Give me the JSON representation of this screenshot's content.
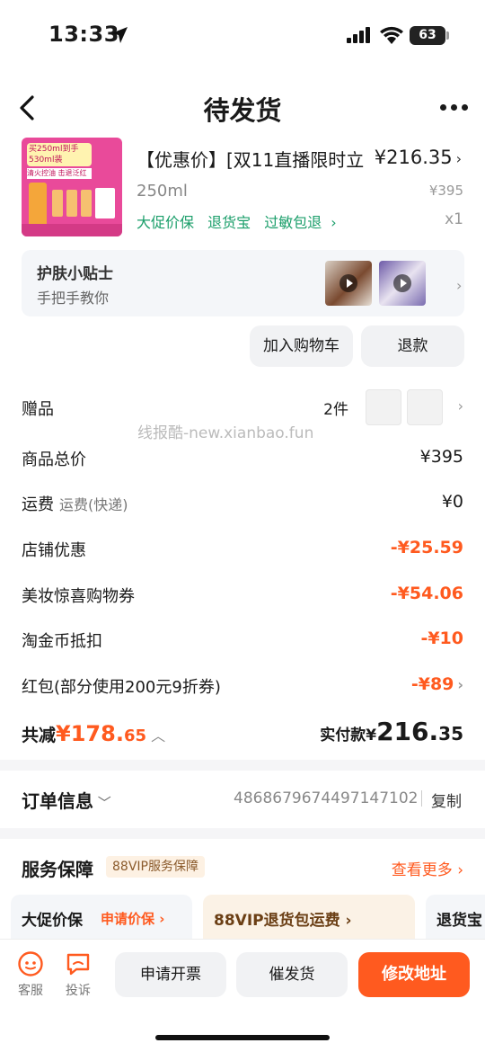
{
  "status_bar": {
    "time": "13:33",
    "battery": "63"
  },
  "nav": {
    "title": "待发货"
  },
  "product": {
    "title": "【优惠价】[双11直播限时立",
    "price": "¥216.35",
    "spec": "250ml",
    "original_price": "¥395",
    "tags": [
      "大促价保",
      "退货宝",
      "过敏包退"
    ],
    "quantity": "x1",
    "image_text": "买250ml到手530ml装",
    "image_text2": "清火控油 击退泛红痘"
  },
  "tips": {
    "title": "护肤小贴士",
    "subtitle": "手把手教你"
  },
  "actions": {
    "add_cart": "加入购物车",
    "refund": "退款"
  },
  "watermark": "线报酷-new.xianbao.fun",
  "details": {
    "gift": {
      "label": "赠品",
      "value": "2件"
    },
    "subtotal": {
      "label": "商品总价",
      "value": "¥395"
    },
    "shipping": {
      "label": "运费",
      "sublabel": "运费(快递)",
      "value": "¥0"
    },
    "store_discount": {
      "label": "店铺优惠",
      "value": "-¥25.59"
    },
    "coupon": {
      "label": "美妆惊喜购物券",
      "value": "-¥54.06"
    },
    "coins": {
      "label": "淘金币抵扣",
      "value": "-¥10"
    },
    "redpacket": {
      "label": "红包(部分使用200元9折券)",
      "value": "-¥89"
    }
  },
  "totals": {
    "saved_label": "共减",
    "saved_int": "¥178.",
    "saved_dec": "65",
    "paid_label": "实付款¥",
    "paid_int": "216.",
    "paid_dec": "35"
  },
  "order": {
    "label": "订单信息",
    "number": "4868679674497147102",
    "copy": "复制"
  },
  "service": {
    "title": "服务保障",
    "badge": "88VIP服务保障",
    "more": "查看更多",
    "cards": [
      {
        "label": "大促价保",
        "action": "申请价保"
      },
      {
        "label": "88VIP退货包运费"
      },
      {
        "label": "退货宝"
      }
    ]
  },
  "bottom": {
    "service_label": "客服",
    "complain_label": "投诉",
    "invoice": "申请开票",
    "urge": "催发货",
    "change_address": "修改地址"
  },
  "colors": {
    "accent": "#ff5a1f",
    "green": "#1a9e6a"
  }
}
